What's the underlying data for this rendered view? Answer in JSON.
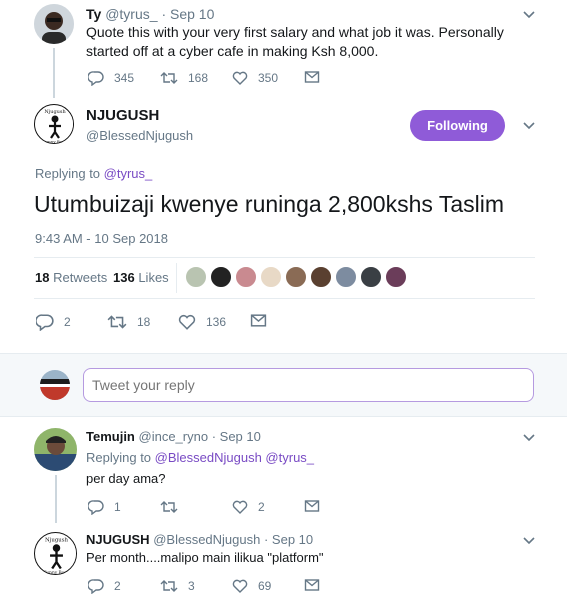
{
  "top_tweet": {
    "name": "Ty",
    "handle": "@tyrus_",
    "date": "· Sep 10",
    "text": "Quote this with your very first salary and what job it was. Personally started off at a cyber cafe in making Ksh 8,000.",
    "replies": "345",
    "retweets": "168",
    "likes": "350"
  },
  "main_tweet": {
    "name": "NJUGUSH",
    "handle": "@BlessedNjugush",
    "follow_label": "Following",
    "replying_prefix": "Replying to",
    "replying_to": "@tyrus_",
    "text": "Utumbuizaji kwenye runinga 2,800kshs Taslim",
    "timestamp": "9:43 AM - 10 Sep 2018",
    "retweet_count": "18",
    "retweet_label": "Retweets",
    "like_count": "136",
    "like_label": "Likes",
    "replies": "2",
    "retweets": "18",
    "likes": "136"
  },
  "reply_box": {
    "placeholder": "Tweet your reply"
  },
  "reply1": {
    "name": "Temujin",
    "handle": "@ince_ryno",
    "date": "· Sep 10",
    "replying_prefix": "Replying to",
    "replying_to": "@BlessedNjugush @tyrus_",
    "text": "per day ama?",
    "replies": "1",
    "retweets": "",
    "likes": "2"
  },
  "reply2": {
    "name": "NJUGUSH",
    "handle": "@BlessedNjugush",
    "date": "· Sep 10",
    "text": "Per month....malipo main ilikua \"platform\"",
    "replies": "2",
    "retweets": "3",
    "likes": "69"
  },
  "colors": {
    "accent": "#794bc4",
    "muted": "#657786",
    "divider": "#e6ecf0"
  }
}
